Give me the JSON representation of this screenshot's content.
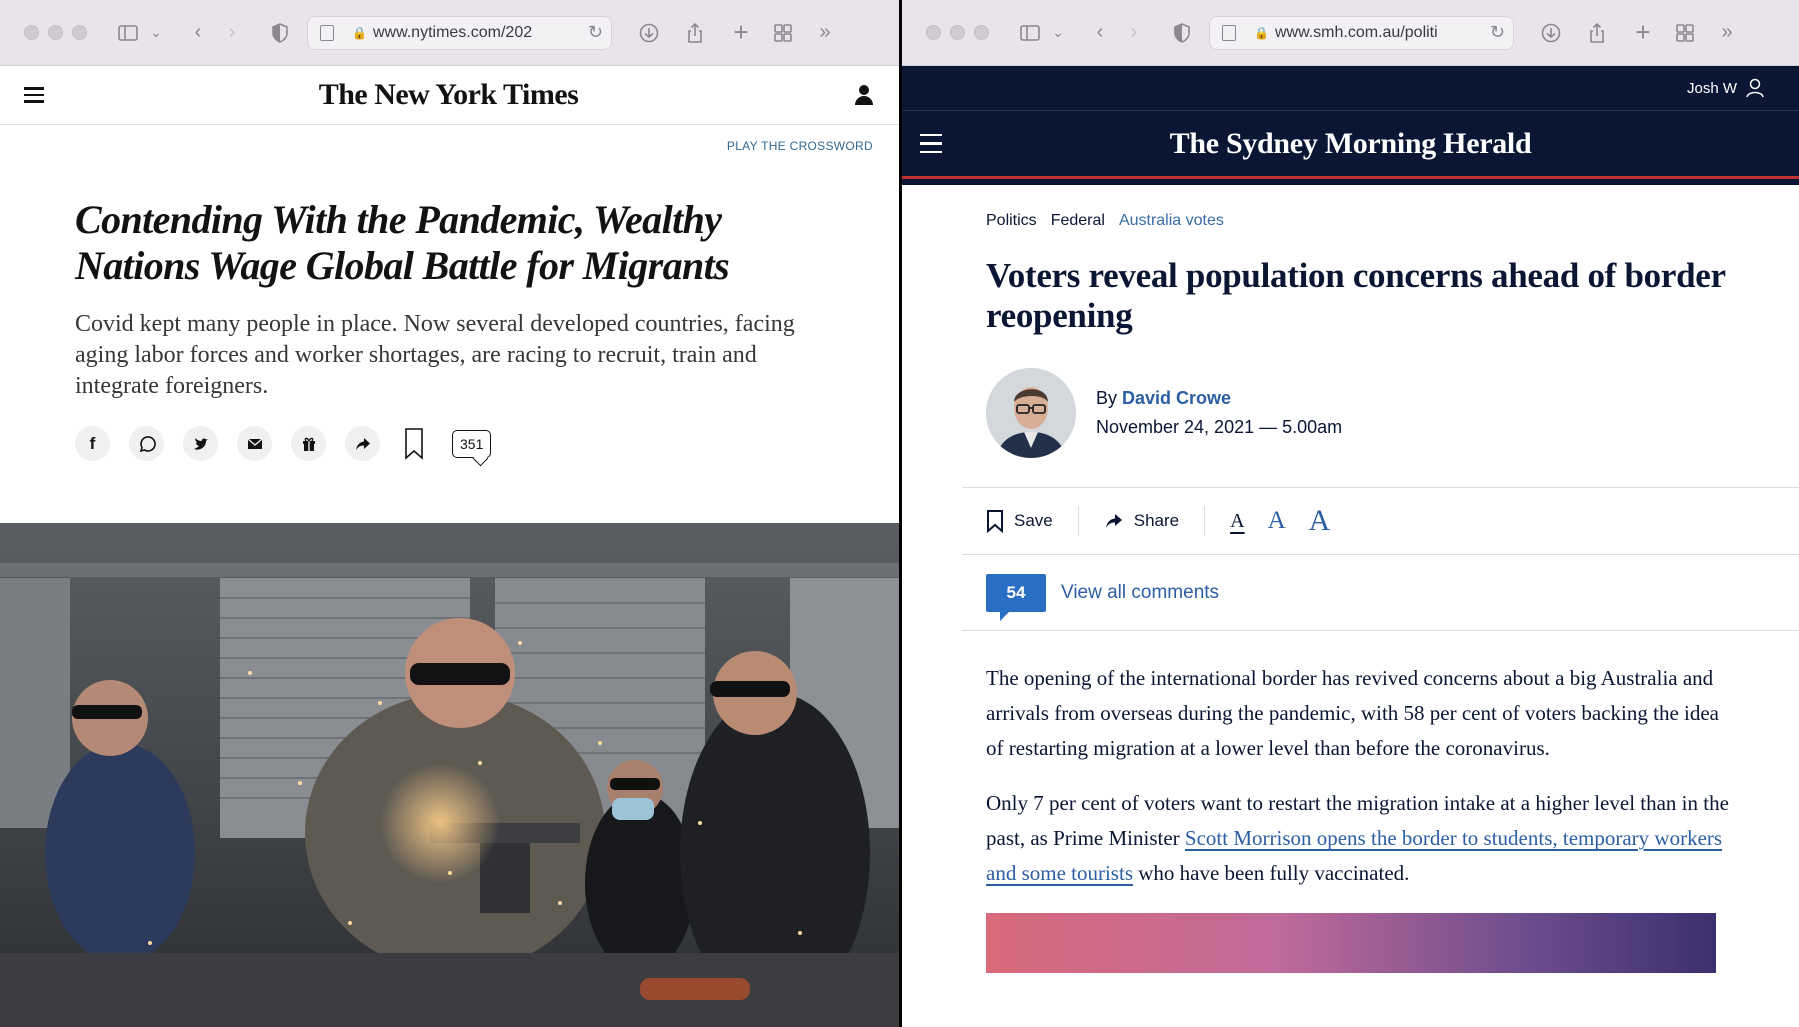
{
  "left_window": {
    "url": "www.nytimes.com/202",
    "logo": "The New York Times",
    "crossword_link": "PLAY THE CROSSWORD",
    "headline": "Contending With the Pandemic, Wealthy Nations Wage Global Battle for Migrants",
    "summary": "Covid kept many people in place. Now several developed countries, facing aging labor forces and worker shortages, are racing to recruit, train and integrate foreigners.",
    "share_icons": [
      "facebook-icon",
      "whatsapp-icon",
      "twitter-icon",
      "email-icon",
      "gift-icon",
      "share-icon"
    ],
    "comment_count": "351"
  },
  "right_window": {
    "url": "www.smh.com.au/politi",
    "user_name": "Josh W",
    "logo": "The Sydney Morning Herald",
    "breadcrumbs": [
      "Politics",
      "Federal",
      "Australia votes"
    ],
    "headline": "Voters reveal population concerns ahead of border reopening",
    "byline_prefix": "By",
    "author": "David Crowe",
    "date": "November 24, 2021 — 5.00am",
    "tools": {
      "save": "Save",
      "share": "Share",
      "font_small": "A",
      "font_medium": "A",
      "font_large": "A"
    },
    "comment_count": "54",
    "view_comments": "View all comments",
    "paragraph1": "The opening of the international border has revived concerns about a big Australia and arrivals from overseas during the pandemic, with 58 per cent of voters backing the idea of restarting migration at a lower level than before the coronavirus.",
    "paragraph2_start": "Only 7 per cent of voters want to restart the migration intake at a higher level than in the past, as Prime Minister ",
    "paragraph2_link": "Scott Morrison opens the border to students, temporary workers and some tourists",
    "paragraph2_end": " who have been fully vaccinated."
  },
  "colors": {
    "smh_navy": "#0a1633",
    "smh_link": "#2b5ea2",
    "smh_badge": "#2b6fc4",
    "nyt_link": "#326891",
    "safari_toolbar": "#e9e4eb"
  }
}
